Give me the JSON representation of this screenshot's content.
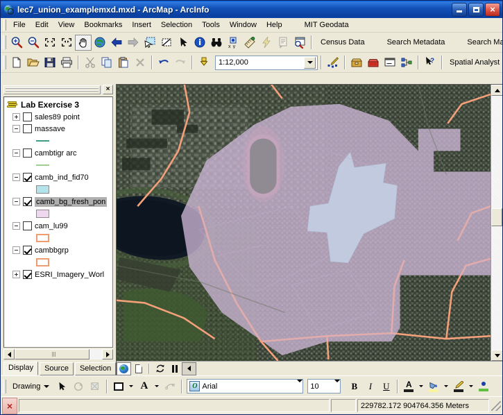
{
  "window": {
    "title": "lec7_union_examplemxd.mxd - ArcMap - ArcInfo",
    "app_icon": "arcmap-globe-icon",
    "minimize_label": "",
    "maximize_label": "",
    "close_label": "×"
  },
  "menubar": {
    "items": [
      {
        "label": "File"
      },
      {
        "label": "Edit"
      },
      {
        "label": "View"
      },
      {
        "label": "Bookmarks"
      },
      {
        "label": "Insert"
      },
      {
        "label": "Selection"
      },
      {
        "label": "Tools"
      },
      {
        "label": "Window"
      },
      {
        "label": "Help"
      },
      {
        "label": "MIT Geodata"
      }
    ]
  },
  "tools_toolbar": {
    "buttons": [
      {
        "name": "zoom-in-icon",
        "tip": "Zoom In"
      },
      {
        "name": "zoom-out-icon",
        "tip": "Zoom Out"
      },
      {
        "name": "fixed-zoom-in-icon",
        "tip": "Fixed Zoom In"
      },
      {
        "name": "fixed-zoom-out-icon",
        "tip": "Fixed Zoom Out"
      },
      {
        "name": "pan-hand-icon",
        "tip": "Pan"
      },
      {
        "name": "full-extent-globe-icon",
        "tip": "Full Extent"
      },
      {
        "name": "go-back-extent-icon",
        "tip": "Go Back To Previous Extent"
      },
      {
        "name": "go-next-extent-icon",
        "tip": "Go To Next Extent"
      },
      {
        "name": "select-features-icon",
        "tip": "Select Features"
      },
      {
        "name": "clear-selected-features-icon",
        "tip": "Clear Selected Features"
      },
      {
        "name": "select-elements-arrow-icon",
        "tip": "Select Elements"
      },
      {
        "name": "identify-icon",
        "tip": "Identify"
      },
      {
        "name": "find-binoculars-icon",
        "tip": "Find"
      },
      {
        "name": "go-to-xy-icon",
        "tip": "Go To XY"
      },
      {
        "name": "measure-icon",
        "tip": "Measure"
      },
      {
        "name": "hyperlink-lightning-icon",
        "tip": "Hyperlink"
      },
      {
        "name": "html-popup-icon",
        "tip": "HTML Popup"
      },
      {
        "name": "create-viewer-window-icon",
        "tip": "Create Viewer Window"
      }
    ],
    "commands": [
      {
        "label": "Census Data"
      },
      {
        "label": "Search Metadata"
      },
      {
        "label": "Search Map"
      }
    ]
  },
  "standard_toolbar": {
    "buttons": [
      {
        "name": "new-document-icon",
        "tip": "New"
      },
      {
        "name": "open-folder-icon",
        "tip": "Open"
      },
      {
        "name": "save-disk-icon",
        "tip": "Save"
      },
      {
        "name": "print-icon",
        "tip": "Print"
      },
      {
        "name": "cut-scissors-icon",
        "tip": "Cut"
      },
      {
        "name": "copy-icon",
        "tip": "Copy"
      },
      {
        "name": "paste-icon",
        "tip": "Paste"
      },
      {
        "name": "delete-x-icon",
        "tip": "Delete"
      },
      {
        "name": "undo-icon",
        "tip": "Undo"
      },
      {
        "name": "redo-icon",
        "tip": "Redo"
      },
      {
        "name": "add-data-icon",
        "tip": "Add Data"
      }
    ],
    "scale": {
      "value": "1:12,000",
      "dropdown_icon": "chevron-down-icon"
    },
    "right_buttons": [
      {
        "name": "editor-toolbar-icon",
        "tip": "Editor Toolbar"
      },
      {
        "name": "arctoolbox-icon",
        "tip": "Show/Hide ArcToolbox Window"
      },
      {
        "name": "python-window-icon",
        "tip": "Show/Hide Command Line Window"
      },
      {
        "name": "model-builder-icon",
        "tip": "ModelBuilder"
      },
      {
        "name": "whats-this-help-icon",
        "tip": "What's This?"
      }
    ],
    "extension_menu": {
      "label": "Spatial Analyst",
      "dropdown_icon": "chevron-down-icon"
    }
  },
  "toc": {
    "close_label": "×",
    "dataframe": {
      "name": "Lab Exercise 3",
      "icon": "data-frame-layers-icon"
    },
    "layers": [
      {
        "name": "sales89 point",
        "checked": false,
        "expander": "plus",
        "symbol": null,
        "selected": false
      },
      {
        "name": "massave",
        "checked": false,
        "expander": "minus",
        "symbol": {
          "type": "line",
          "color": "#3f9d86"
        },
        "selected": false
      },
      {
        "name": "cambtigr arc",
        "checked": false,
        "expander": "minus",
        "symbol": {
          "type": "line",
          "color": "#9fd090"
        },
        "selected": false
      },
      {
        "name": "camb_ind_fid70",
        "checked": true,
        "expander": "minus",
        "symbol": {
          "type": "polygon",
          "fill": "#b5e3ec",
          "outline": "#8d8d8d"
        },
        "selected": false
      },
      {
        "name": "camb_bg_fresh_pon",
        "checked": true,
        "expander": "minus",
        "symbol": {
          "type": "polygon",
          "fill": "#f0d7f0",
          "outline": "#8d8d8d"
        },
        "selected": true
      },
      {
        "name": "cam_lu99",
        "checked": false,
        "expander": "minus",
        "symbol": {
          "type": "polygon",
          "fill": "none",
          "outline": "#f09c72"
        },
        "selected": false
      },
      {
        "name": "cambbgrp",
        "checked": true,
        "expander": "minus",
        "symbol": {
          "type": "polygon",
          "fill": "none",
          "outline": "#f09c72"
        },
        "selected": false
      },
      {
        "name": "ESRI_Imagery_Worl",
        "checked": true,
        "expander": "plus",
        "symbol": null,
        "selected": false
      }
    ],
    "tabs": [
      {
        "label": "Display",
        "active": true
      },
      {
        "label": "Source",
        "active": false
      },
      {
        "label": "Selection",
        "active": false
      }
    ],
    "scroll_left_icon": "scroll-left-arrow-icon",
    "scroll_right_icon": "scroll-right-arrow-icon"
  },
  "map": {
    "selection_outline_color": "#ffff00",
    "block_group_outline_color": "#f4a07a",
    "industrial_polygon_color": "#b9e6ef",
    "fresh_pond_block_color": "#cfb8d8",
    "water_color": "#101a24",
    "bottom_buttons": [
      {
        "name": "data-view-button",
        "icon": "globe-icon",
        "active": true
      },
      {
        "name": "layout-view-button",
        "icon": "page-icon",
        "active": false
      },
      {
        "name": "refresh-view-button",
        "icon": "refresh-arrows-icon",
        "active": false
      },
      {
        "name": "pause-drawing-button",
        "icon": "pause-icon",
        "active": false
      },
      {
        "name": "scroll-left-button",
        "icon": "left-arrow-icon",
        "active": true
      }
    ]
  },
  "drawing_toolbar": {
    "menu": {
      "label": "Drawing",
      "dropdown_icon": "chevron-down-icon"
    },
    "buttons": [
      {
        "name": "select-elements-arrow-icon",
        "tip": "Select Elements"
      },
      {
        "name": "rotate-element-icon",
        "tip": "Rotate"
      },
      {
        "name": "snap-to-icon",
        "tip": "Snapping"
      },
      {
        "name": "new-rectangle-icon",
        "tip": "Drawing Shape"
      },
      {
        "name": "new-text-icon",
        "tip": "New Text"
      },
      {
        "name": "nudge-icon",
        "tip": "Nudge"
      }
    ],
    "font": {
      "value": "Arial",
      "icon": "open-type-font-icon"
    },
    "font_size": {
      "value": "10"
    },
    "bold_label": "B",
    "italic_label": "I",
    "underline_label": "U",
    "color_buttons": [
      {
        "name": "font-color-button",
        "glyph": "A",
        "color": "#f7f3a0"
      },
      {
        "name": "fill-color-button",
        "glyph": "fill-bucket-icon",
        "color": "#f7f3a0"
      },
      {
        "name": "line-color-button",
        "glyph": "pencil-line-icon",
        "color": "#1d1d1d"
      },
      {
        "name": "marker-color-button",
        "glyph": "marker-dot-icon",
        "color": "#5fbf3f"
      }
    ]
  },
  "statusbar": {
    "close_label": "×",
    "message": "",
    "coordinates": "229782.172  904764.356 Meters"
  }
}
